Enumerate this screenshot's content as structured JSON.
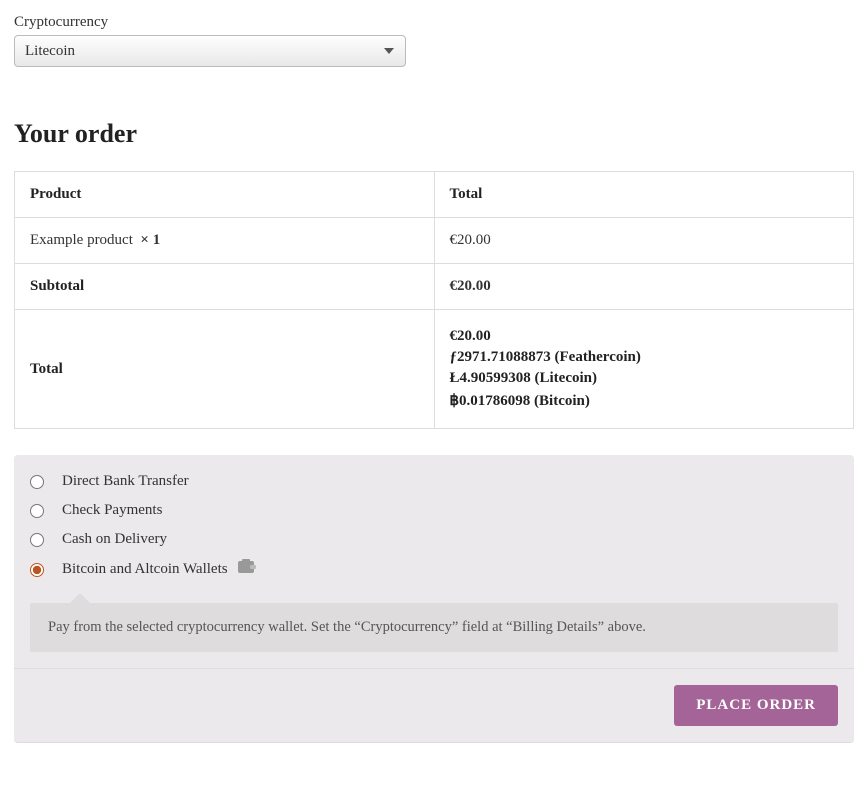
{
  "crypto_field": {
    "label": "Cryptocurrency",
    "selected": "Litecoin"
  },
  "order": {
    "heading": "Your order",
    "headers": {
      "product": "Product",
      "total": "Total"
    },
    "item": {
      "name": "Example product",
      "qty": "× 1",
      "total": "€20.00"
    },
    "subtotal": {
      "label": "Subtotal",
      "value": "€20.00"
    },
    "total": {
      "label": "Total",
      "eur": "€20.00",
      "feathercoin": "ƒ2971.71088873 (Feathercoin)",
      "litecoin": "Ł4.90599308 (Litecoin)",
      "bitcoin": "฿0.01786098 (Bitcoin)"
    }
  },
  "payment": {
    "methods": {
      "bank": "Direct Bank Transfer",
      "check": "Check Payments",
      "cod": "Cash on Delivery",
      "wallets": "Bitcoin and Altcoin Wallets"
    },
    "selected": "wallets",
    "description": "Pay from the selected cryptocurrency wallet. Set the “Cryptocurrency” field at “Billing Details” above."
  },
  "actions": {
    "place_order": "PLACE ORDER"
  }
}
